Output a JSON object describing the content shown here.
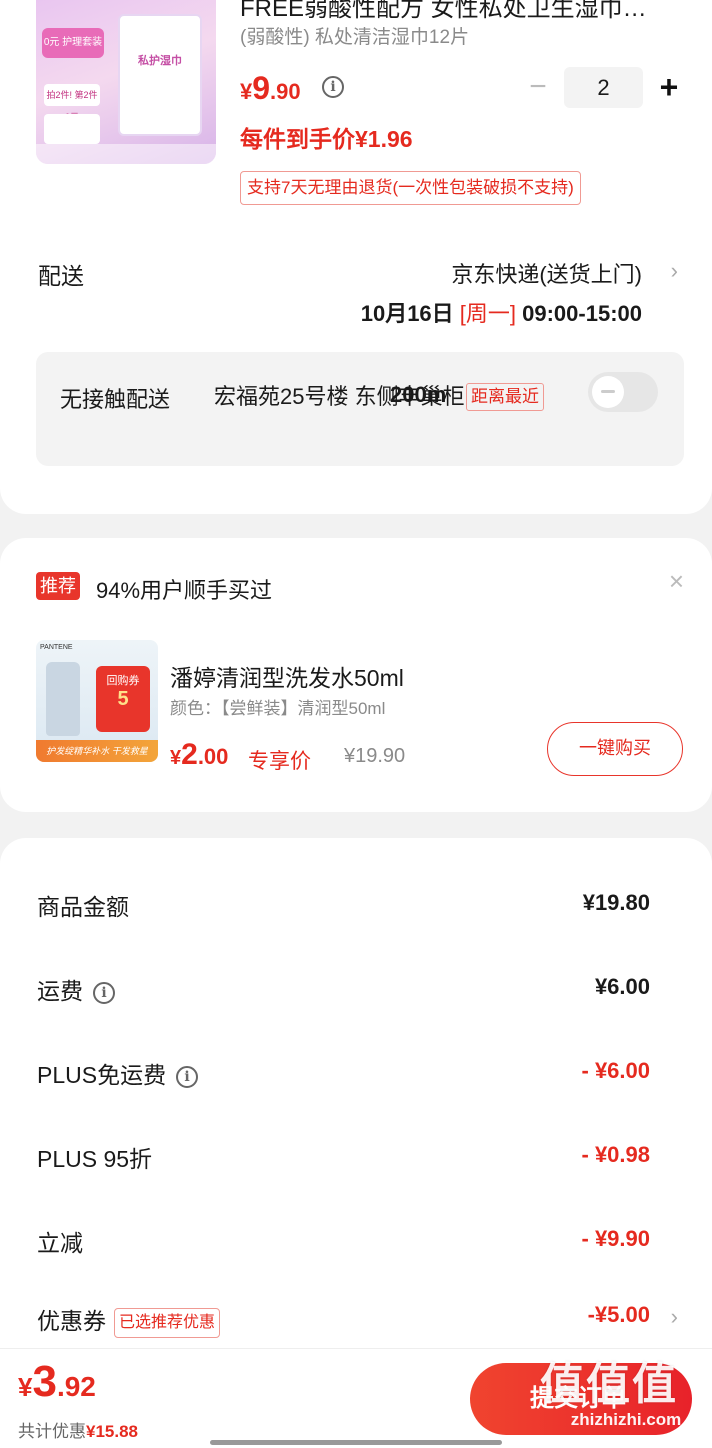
{
  "product": {
    "title": "FREE弱酸性配方 女性私处卫生湿巾…",
    "subtitle": "(弱酸性) 私处清洁湿巾12片",
    "image_text": "私护湿巾",
    "image_tag_top": "0元 护理套装",
    "image_tag_mid": "拍2件! 第2件0元",
    "price_currency": "¥",
    "price_int": "9",
    "price_dec": ".90",
    "quantity": "2",
    "minus_label": "−",
    "plus_label": "+",
    "per_item_price": "每件到手价¥1.96",
    "return_policy": "支持7天无理由退货(一次性包装破损不支持)"
  },
  "delivery": {
    "label": "配送",
    "method": "京东快递(送货上门)",
    "date": "10月16日 ",
    "weekday": "[周一]",
    "time": " 09:00-15:00",
    "contactless_label": "无接触配送",
    "locker_address": "宏福苑25号楼 东侧丰巢柜",
    "distance": "200m",
    "nearest_badge": "距离最近",
    "toggle_on": false
  },
  "recommend": {
    "badge": "推荐",
    "headline": "94%用户顺手买过",
    "close": "×",
    "image_brand": "PANTENE",
    "image_coupon_label": "回购券",
    "image_coupon_value": "5",
    "image_strip": "护发绽精华补水 干发救星",
    "name": "潘婷清润型洗发水50ml",
    "spec": "颜色：【尝鲜装】清润型50ml",
    "price_currency": "¥",
    "price_int": "2",
    "price_dec": ".00",
    "price_label": "专享价",
    "original_price": "¥19.90",
    "buy_button": "一键购买"
  },
  "summary": {
    "rows": [
      {
        "label": "商品金额",
        "value": "¥19.80"
      },
      {
        "label": "运费",
        "value": "¥6.00"
      },
      {
        "label": "PLUS免运费",
        "value": "- ¥6.00"
      },
      {
        "label": "PLUS 95折",
        "value": "- ¥0.98"
      },
      {
        "label": "立减",
        "value": "- ¥9.90"
      },
      {
        "label": "优惠券",
        "value": "-¥5.00",
        "tag": "已选推荐优惠"
      }
    ]
  },
  "bottom": {
    "total_currency": "¥",
    "total_int": "3",
    "total_dec": ".92",
    "saving_prefix": "共计优惠",
    "saving_amount": "¥15.88",
    "submit_label": "提交订单",
    "watermark": "值值值",
    "watermark_url": "zhizhizhi.com"
  },
  "colors": {
    "accent": "#e52a1f",
    "muted": "#8a8a8a"
  }
}
